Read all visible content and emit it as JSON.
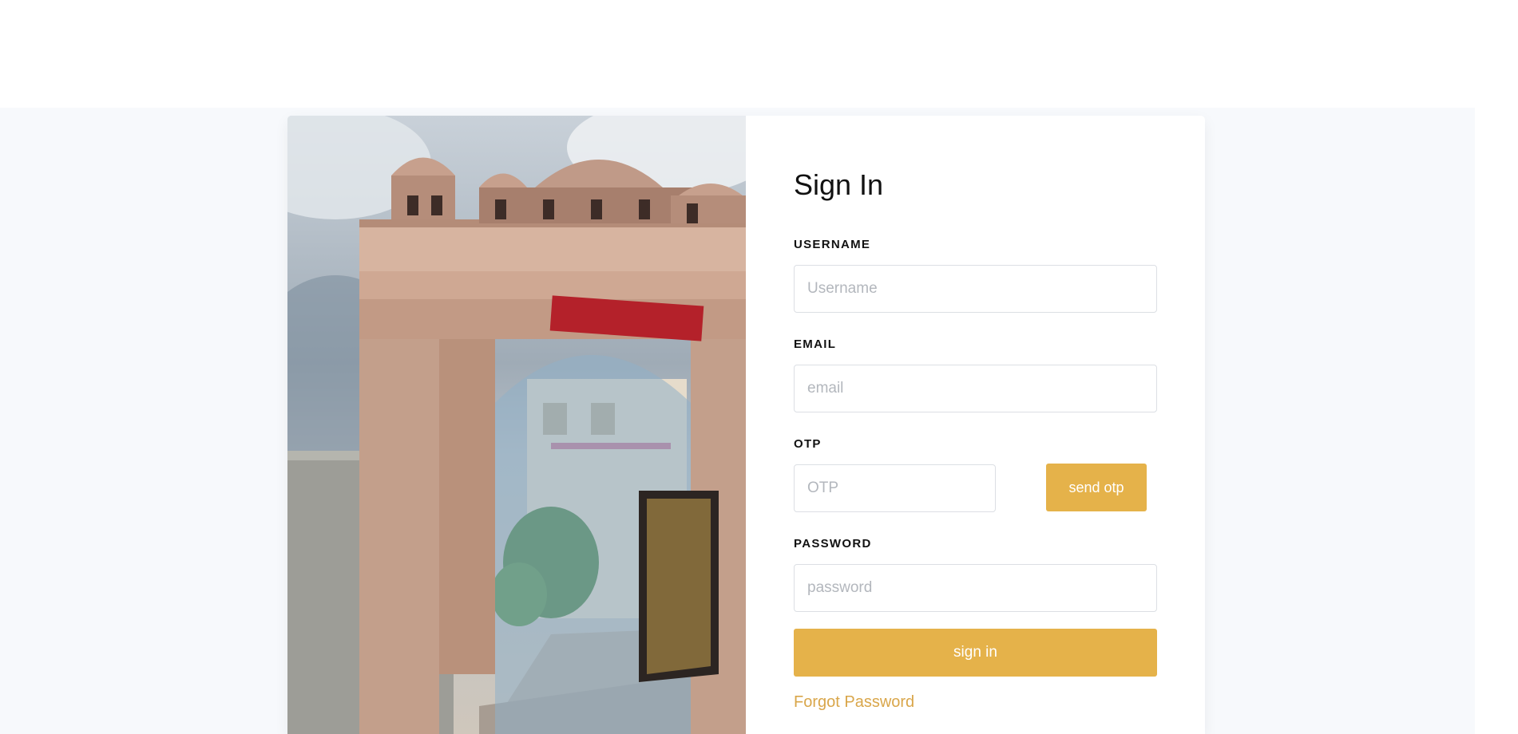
{
  "form": {
    "title": "Sign In",
    "username": {
      "label": "USERNAME",
      "placeholder": "Username",
      "value": ""
    },
    "email": {
      "label": "EMAIL",
      "placeholder": "email",
      "value": ""
    },
    "otp": {
      "label": "OTP",
      "placeholder": "OTP",
      "value": "",
      "button": "send otp"
    },
    "password": {
      "label": "PASSWORD",
      "placeholder": "password",
      "value": ""
    },
    "submit": "sign in",
    "forgot": "Forgot Password"
  },
  "colors": {
    "accent": "#e5b24a",
    "link": "#d9a64a",
    "background": "#f7f9fc"
  }
}
